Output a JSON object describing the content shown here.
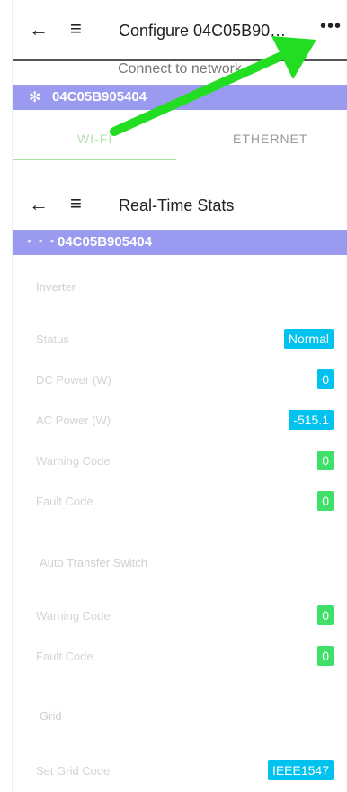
{
  "header1": {
    "title": "Configure 04C05B90…",
    "back_icon": "←",
    "menu_icon": "≡",
    "more_icon": "•••"
  },
  "connect": {
    "label": "Connect to network"
  },
  "device1": {
    "bt_icon": "✻",
    "id": "04C05B905404"
  },
  "tabs": [
    {
      "label": "WI-FI"
    },
    {
      "label": "ETHERNET"
    }
  ],
  "header2": {
    "title": "Real-Time Stats",
    "back_icon": "←",
    "menu_icon": "≡"
  },
  "device2": {
    "dots_icon": "• • •",
    "id": "04C05B905404"
  },
  "sections": {
    "inverter": "Inverter",
    "ats": "Auto Transfer Switch",
    "grid": "Grid"
  },
  "rows": {
    "status": {
      "label": "Status",
      "value": "Normal"
    },
    "dc_power": {
      "label": "DC Power (W)",
      "value": "0"
    },
    "ac_power": {
      "label": "AC Power (W)",
      "value": "-515.1"
    },
    "inv_warning": {
      "label": "Warning Code",
      "value": "0"
    },
    "inv_fault": {
      "label": "Fault Code",
      "value": "0"
    },
    "ats_warning": {
      "label": "Warning Code",
      "value": "0"
    },
    "ats_fault": {
      "label": "Fault Code",
      "value": "0"
    },
    "grid_code": {
      "label": "Set Grid Code",
      "value": "IEEE1547"
    }
  },
  "colors": {
    "device_bar": "#9a9af0",
    "badge_blue": "#00c2ee",
    "badge_green": "#3fe06a",
    "arrow": "#22dd22"
  }
}
